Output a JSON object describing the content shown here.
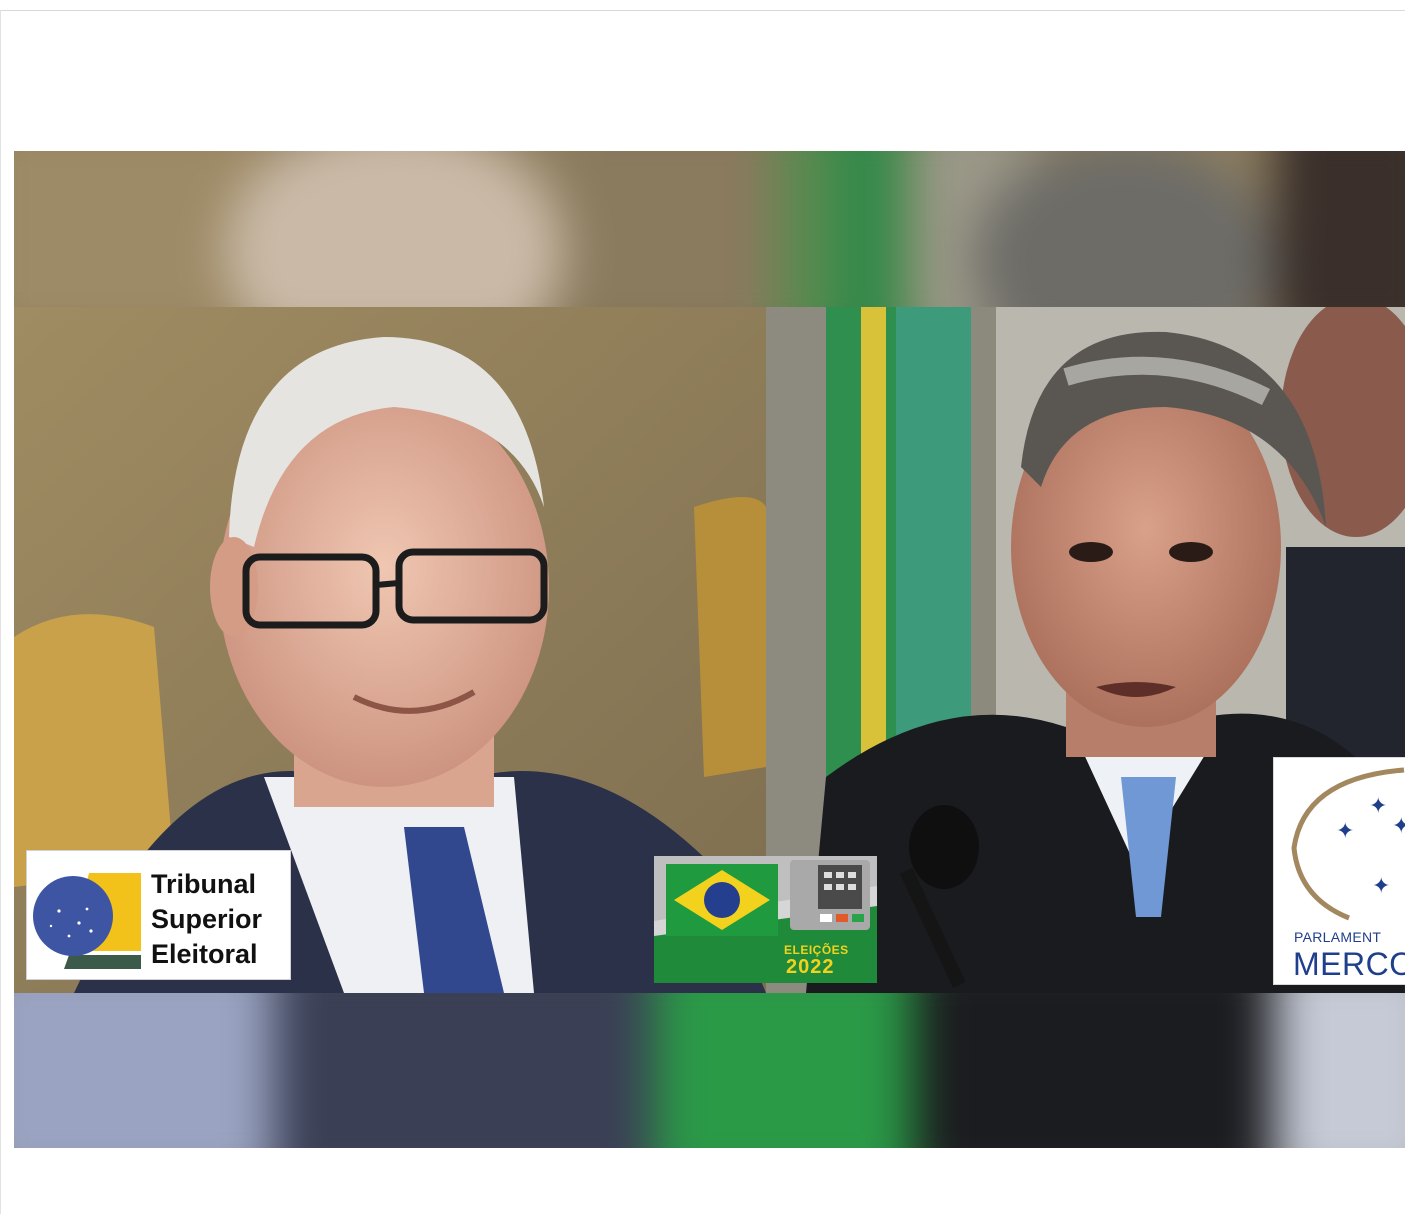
{
  "image": {
    "left_subject": "smiling older man with white hair and glasses in a dark suit",
    "right_subject": "man with grey hair speaking, dark coat and blue tie"
  },
  "logos": {
    "tse": {
      "line1": "Tribunal",
      "line2": "Superior",
      "line3": "Eleitoral"
    },
    "elections": {
      "label": "ELEIÇÕES",
      "year": "2022"
    },
    "parlasur": {
      "line1": "PARLAMENT",
      "line2": "MERCO"
    }
  },
  "colors": {
    "brazil_green": "#1f8a3a",
    "brazil_yellow": "#f2d21c",
    "brazil_blue": "#253f8f",
    "parlasur_blue": "#1f3f8c"
  }
}
